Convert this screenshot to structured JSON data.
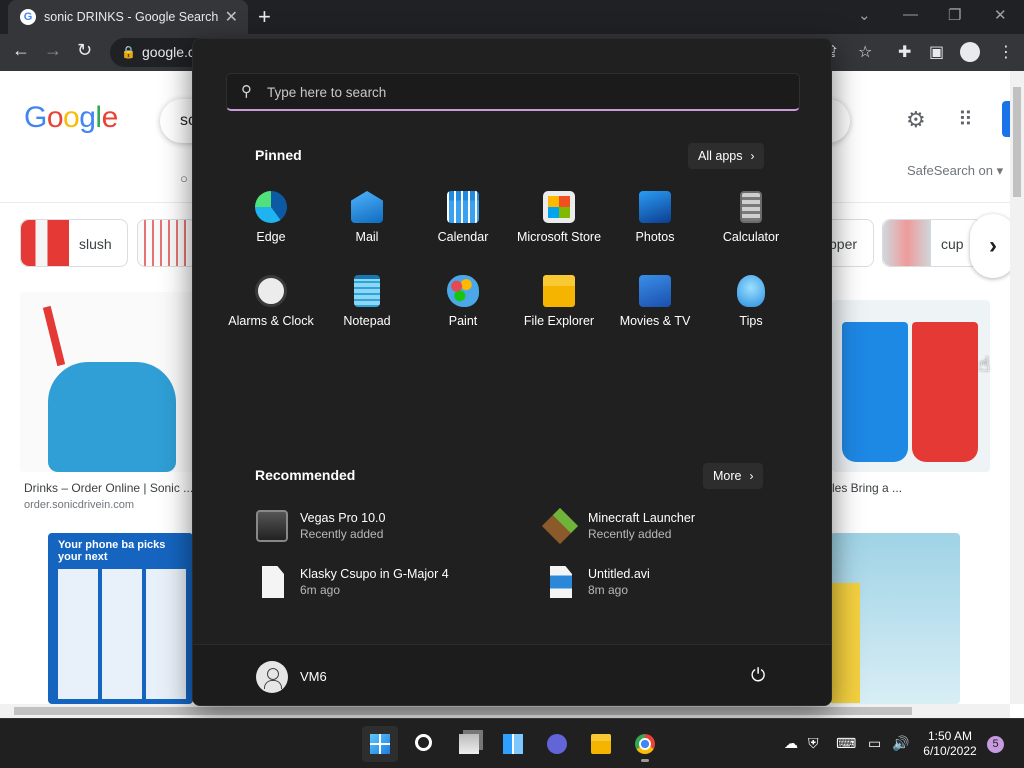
{
  "browser": {
    "tab_title": "sonic DRINKS - Google Search",
    "favicon_letter": "G",
    "url_text": "google.c",
    "tab_close": "✕",
    "new_tab": "+",
    "window_controls": [
      "⌄",
      "—",
      "❐",
      "✕"
    ]
  },
  "google": {
    "logo": "Google",
    "query": "sc",
    "safesearch": "SafeSearch on ▾",
    "chips": [
      {
        "label": "slush"
      },
      {
        "label": "pper"
      },
      {
        "label": "cup"
      }
    ],
    "results": [
      {
        "title": "Drinks – Order Online | Sonic ...",
        "source": "order.sonicdrivein.com"
      },
      {
        "title": "les Bring a ..."
      }
    ],
    "promo_text": "Your phone ba picks your next"
  },
  "start_menu": {
    "search_placeholder": "Type here to search",
    "pinned_title": "Pinned",
    "all_apps_label": "All apps",
    "pinned": [
      {
        "label": "Edge",
        "icon": "edge-icon"
      },
      {
        "label": "Mail",
        "icon": "mail-icon"
      },
      {
        "label": "Calendar",
        "icon": "calendar-icon"
      },
      {
        "label": "Microsoft Store",
        "icon": "store-icon"
      },
      {
        "label": "Photos",
        "icon": "photos-icon"
      },
      {
        "label": "Calculator",
        "icon": "calculator-icon"
      },
      {
        "label": "Alarms & Clock",
        "icon": "clock-icon"
      },
      {
        "label": "Notepad",
        "icon": "notepad-icon"
      },
      {
        "label": "Paint",
        "icon": "paint-icon"
      },
      {
        "label": "File Explorer",
        "icon": "folder-icon"
      },
      {
        "label": "Movies & TV",
        "icon": "movies-icon"
      },
      {
        "label": "Tips",
        "icon": "tips-icon"
      }
    ],
    "recommended_title": "Recommended",
    "more_label": "More",
    "recommended": [
      {
        "name": "Vegas Pro 10.0",
        "sub": "Recently added"
      },
      {
        "name": "Minecraft Launcher",
        "sub": "Recently added"
      },
      {
        "name": "Klasky Csupo in G-Major 4",
        "sub": "6m ago"
      },
      {
        "name": "Untitled.avi",
        "sub": "8m ago"
      }
    ],
    "user_name": "VM6"
  },
  "taskbar": {
    "time": "1:50 AM",
    "date": "6/10/2022",
    "notification_count": "5"
  },
  "colors": {
    "start_bg": "#202020",
    "search_underline": "#c99cd8",
    "taskbar_bg": "#202020",
    "chrome_dark": "#35363a"
  }
}
